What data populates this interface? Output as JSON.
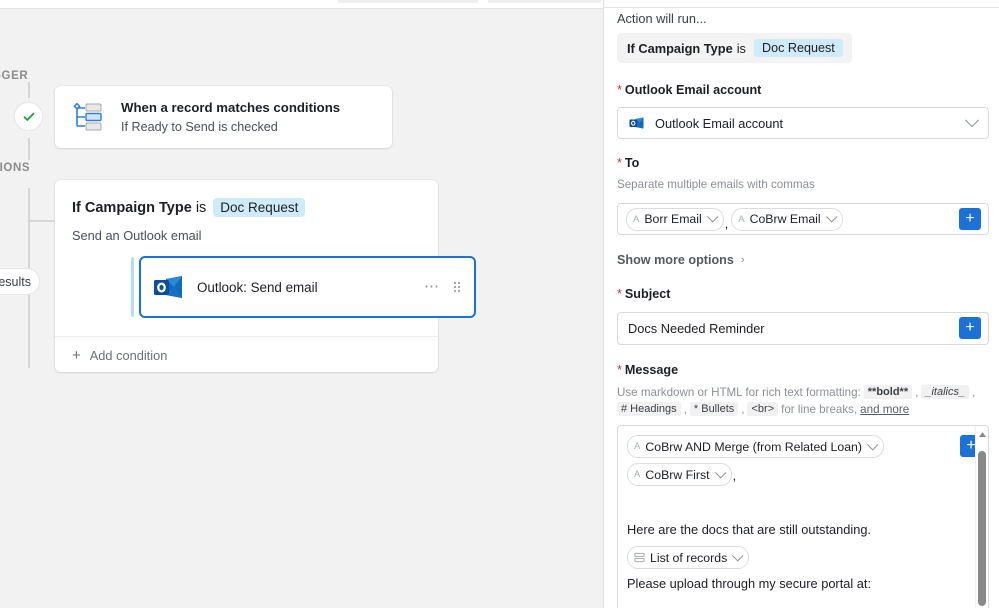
{
  "left_canvas": {
    "rail": {
      "trigger_label": "GGER",
      "actions_label": "TIONS",
      "status_icon": "check-icon",
      "results_pill_label": "esults"
    },
    "trigger_card": {
      "icon": "condition-branch-icon",
      "title": "When a record matches conditions",
      "subtitle": "If Ready to Send is checked"
    },
    "action_card": {
      "condition_prefix": "If Campaign Type",
      "condition_verb": "is",
      "condition_value": "Doc Request",
      "subtitle": "Send an Outlook email",
      "step": {
        "icon": "outlook-icon",
        "label": "Outlook: Send email",
        "more_icon": "ellipsis-icon",
        "drag_icon": "drag-handle-icon"
      },
      "add_condition_label": "Add condition",
      "add_condition_icon": "plus-icon"
    }
  },
  "right_panel": {
    "action_will_run": "Action will run...",
    "condition": {
      "prefix": "If Campaign Type",
      "verb": "is",
      "value": "Doc Request"
    },
    "account": {
      "label": "Outlook Email account",
      "required": "*",
      "icon": "outlook-icon",
      "value": "Outlook Email account",
      "chevron_icon": "chevron-down-icon"
    },
    "to": {
      "label": "To",
      "required": "*",
      "hint": "Separate multiple emails with commas",
      "tokens": [
        {
          "icon": "field-token-icon",
          "label": "Borr Email",
          "chevron_icon": "chevron-down-icon"
        },
        {
          "icon": "field-token-icon",
          "label": "CoBrw Email",
          "chevron_icon": "chevron-down-icon"
        }
      ],
      "separator": ",",
      "add_button_icon": "plus-icon"
    },
    "show_more_options": {
      "label": "Show more options",
      "chevron_icon": "chevron-right-icon"
    },
    "subject": {
      "label": "Subject",
      "required": "*",
      "value": "Docs Needed Reminder",
      "add_button_icon": "plus-icon"
    },
    "message": {
      "label": "Message",
      "required": "*",
      "hint_line1_prefix": "Use markdown or HTML for rich text formatting:",
      "hint_bold": "**bold**",
      "hint_comma1": ",",
      "hint_italics": "_italics_",
      "hint_comma2": ",",
      "hint_headings": "# Headings",
      "hint_comma3": ",",
      "hint_bullets": "* Bullets",
      "hint_comma4": ",",
      "hint_br": "<br>",
      "hint_linebreaks": "for line breaks,",
      "hint_more_link": "and more",
      "add_button_icon": "plus-icon",
      "body": {
        "token_row_1": [
          {
            "icon": "field-token-icon",
            "label": "CoBrw AND Merge (from Related Loan)",
            "chevron_icon": "chevron-down-icon"
          }
        ],
        "token_row_2": [
          {
            "icon": "field-token-icon",
            "label": "CoBrw First",
            "chevron_icon": "chevron-down-icon"
          }
        ],
        "token_row_2_trailing": ",",
        "line_1": "Here are the docs that are still outstanding.",
        "records_token": {
          "icon": "list-records-icon",
          "label": "List of records",
          "chevron_icon": "chevron-down-icon"
        },
        "line_2": "Please upload through my secure portal at:"
      },
      "scrollbar": {
        "up_icon": "scroll-up-arrow-icon"
      }
    }
  },
  "colors": {
    "accent_blue": "#1b72d4",
    "pill_blue": "#cfeaf8",
    "required_red": "#d93025",
    "check_green": "#1e9e4a",
    "canvas_gray": "#f2f2f2"
  }
}
